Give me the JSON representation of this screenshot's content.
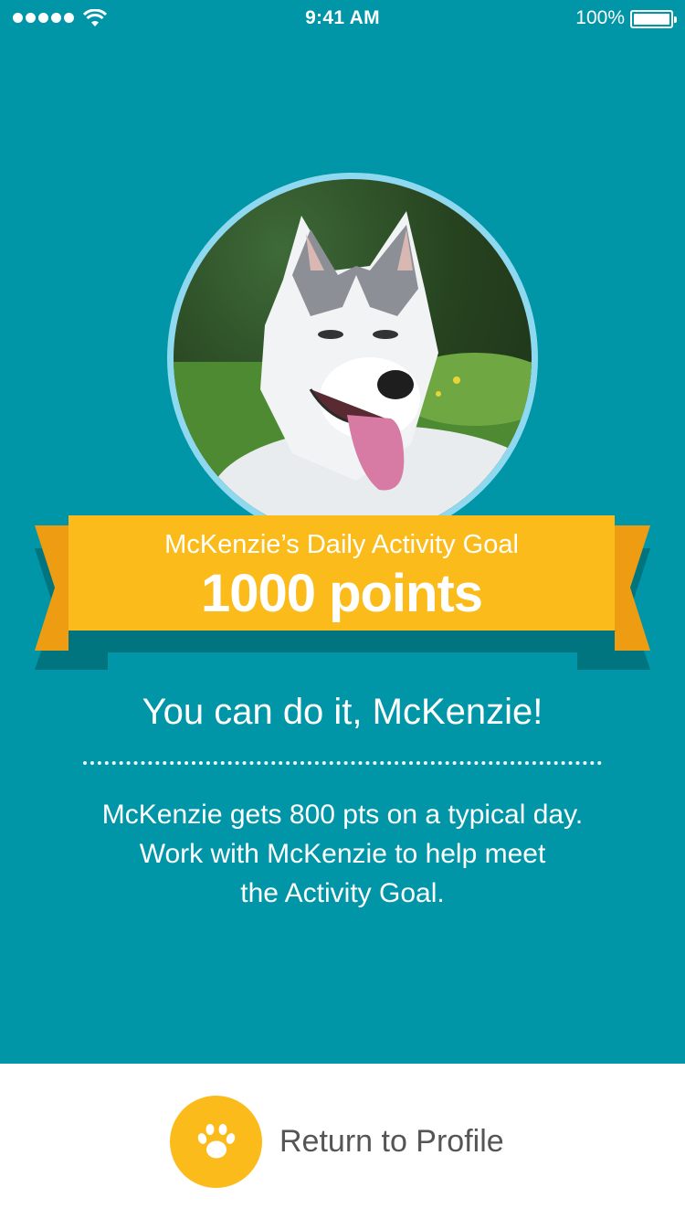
{
  "status_bar": {
    "time": "9:41 AM",
    "battery_percent": "100%",
    "signal_icon": "cellular-signal-icon",
    "wifi_icon": "wifi-icon",
    "battery_icon": "battery-icon"
  },
  "profile": {
    "photo_icon": "dog-photo"
  },
  "goal_banner": {
    "subtitle": "McKenzie’s Daily Activity Goal",
    "value": "1000 points"
  },
  "message": {
    "headline": "You can do it, McKenzie!",
    "lines": [
      "McKenzie gets 800 pts on a typical day.",
      "Work with McKenzie to help meet",
      "the Activity Goal."
    ]
  },
  "footer": {
    "return_label": "Return to Profile",
    "button_icon": "paw-icon"
  },
  "colors": {
    "background": "#0096a8",
    "ribbon": "#fbbb1a",
    "ribbon_dark": "#e69a12",
    "accent_ring": "#8fd9f0",
    "footer_bg": "#ffffff"
  }
}
